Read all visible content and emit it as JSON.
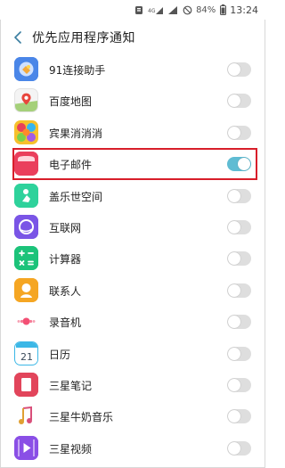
{
  "status_bar": {
    "battery_percent": "84%",
    "time": "13:24",
    "network_label": "4G"
  },
  "header": {
    "title": "优先应用程序通知",
    "back_icon": "chevron-left-icon"
  },
  "apps": [
    {
      "label": "91连接助手",
      "enabled": false,
      "icon": "91-assistant-icon",
      "color": "#3b7be0"
    },
    {
      "label": "百度地图",
      "enabled": false,
      "icon": "baidu-map-icon",
      "color": "#f2f2f2"
    },
    {
      "label": "宾果消消消",
      "enabled": false,
      "icon": "bingo-game-icon",
      "color": "#e84f6a"
    },
    {
      "label": "电子邮件",
      "enabled": true,
      "icon": "email-icon",
      "color": "#e83e5a"
    },
    {
      "label": "盖乐世空间",
      "enabled": false,
      "icon": "galaxy-space-icon",
      "color": "#2ed29b"
    },
    {
      "label": "互联网",
      "enabled": false,
      "icon": "internet-icon",
      "color": "#7a55e6"
    },
    {
      "label": "计算器",
      "enabled": false,
      "icon": "calculator-icon",
      "color": "#1cc37a"
    },
    {
      "label": "联系人",
      "enabled": false,
      "icon": "contacts-icon",
      "color": "#f5a623"
    },
    {
      "label": "录音机",
      "enabled": false,
      "icon": "voice-recorder-icon",
      "color": "#f34f74"
    },
    {
      "label": "日历",
      "enabled": false,
      "icon": "calendar-icon",
      "color": "#3bb7e6"
    },
    {
      "label": "三星笔记",
      "enabled": false,
      "icon": "samsung-notes-icon",
      "color": "#e2455b"
    },
    {
      "label": "三星牛奶音乐",
      "enabled": false,
      "icon": "milk-music-icon",
      "color": "#d9534f"
    },
    {
      "label": "三星视频",
      "enabled": false,
      "icon": "samsung-video-icon",
      "color": "#8a4fe6"
    }
  ]
}
